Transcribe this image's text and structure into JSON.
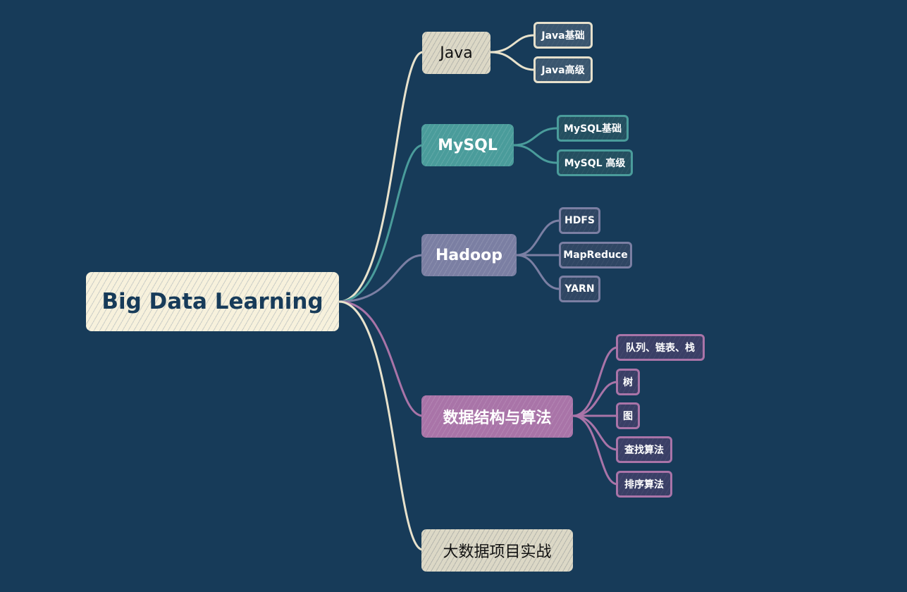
{
  "colors": {
    "background": "#173b59",
    "cream": "#f7f1dc",
    "beige": "#dcd8c6",
    "teal": "#4a9c9b",
    "slate": "#7b7fa3",
    "purple": "#a974a8",
    "root_text": "#173b59"
  },
  "root": {
    "label": "Big Data Learning"
  },
  "branches": {
    "java": {
      "label": "Java",
      "children": [
        "Java基础",
        "Java高级"
      ]
    },
    "mysql": {
      "label": "MySQL",
      "children": [
        "MySQL基础",
        "MySQL 高级"
      ]
    },
    "hadoop": {
      "label": "Hadoop",
      "children": [
        "HDFS",
        "MapReduce",
        "YARN"
      ]
    },
    "ds": {
      "label": "数据结构与算法",
      "children": [
        "队列、链表、栈",
        "树",
        "图",
        "查找算法",
        "排序算法"
      ]
    },
    "project": {
      "label": "大数据项目实战",
      "children": []
    }
  }
}
